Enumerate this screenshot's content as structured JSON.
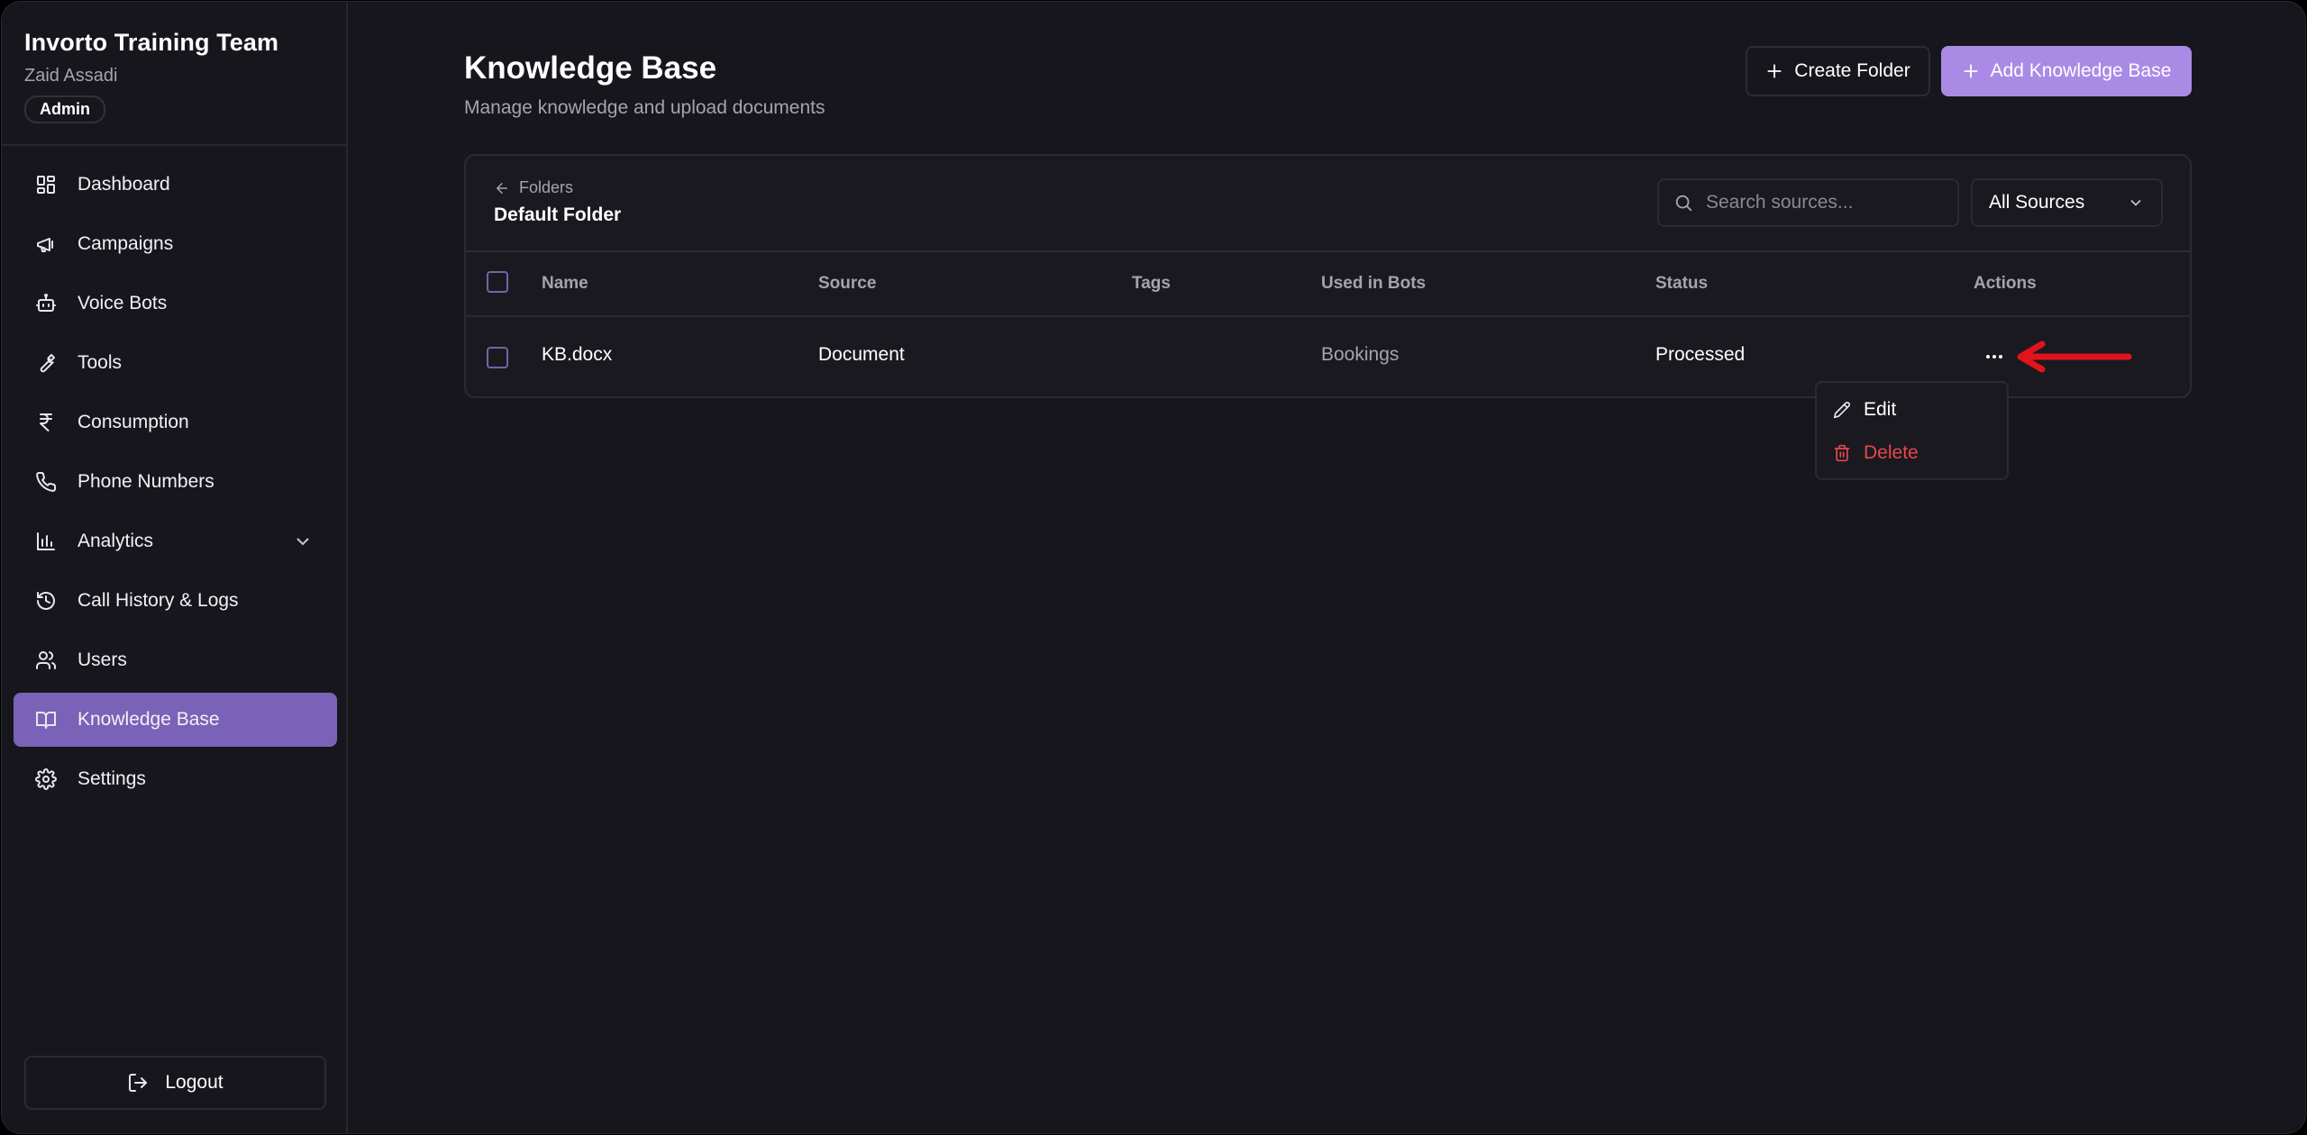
{
  "sidebar": {
    "org_name": "Invorto Training Team",
    "user_name": "Zaid Assadi",
    "role_badge": "Admin",
    "items": [
      {
        "label": "Dashboard",
        "icon": "dashboard-icon"
      },
      {
        "label": "Campaigns",
        "icon": "megaphone-icon"
      },
      {
        "label": "Voice Bots",
        "icon": "bot-icon"
      },
      {
        "label": "Tools",
        "icon": "wrench-icon"
      },
      {
        "label": "Consumption",
        "icon": "rupee-icon"
      },
      {
        "label": "Phone Numbers",
        "icon": "phone-icon"
      },
      {
        "label": "Analytics",
        "icon": "bar-chart-icon"
      },
      {
        "label": "Call History & Logs",
        "icon": "history-icon"
      },
      {
        "label": "Users",
        "icon": "users-icon"
      },
      {
        "label": "Knowledge Base",
        "icon": "book-icon",
        "active": true
      },
      {
        "label": "Settings",
        "icon": "gear-icon"
      }
    ],
    "logout_label": "Logout"
  },
  "header": {
    "title": "Knowledge Base",
    "subtitle": "Manage knowledge and upload documents",
    "create_folder_label": "Create Folder",
    "add_kb_label": "Add Knowledge Base"
  },
  "card": {
    "breadcrumb_back": "Folders",
    "folder_name": "Default Folder",
    "search_placeholder": "Search sources...",
    "source_filter": "All Sources",
    "columns": [
      "Name",
      "Source",
      "Tags",
      "Used in Bots",
      "Status",
      "Actions"
    ],
    "rows": [
      {
        "name": "KB.docx",
        "source": "Document",
        "tags": "",
        "used_in_bots": "Bookings",
        "status": "Processed"
      }
    ]
  },
  "action_menu": {
    "edit_label": "Edit",
    "delete_label": "Delete"
  },
  "colors": {
    "accent": "#a98be6",
    "active_nav": "#7a62b8",
    "danger": "#e5484d",
    "annotation_arrow": "#e0141b"
  }
}
